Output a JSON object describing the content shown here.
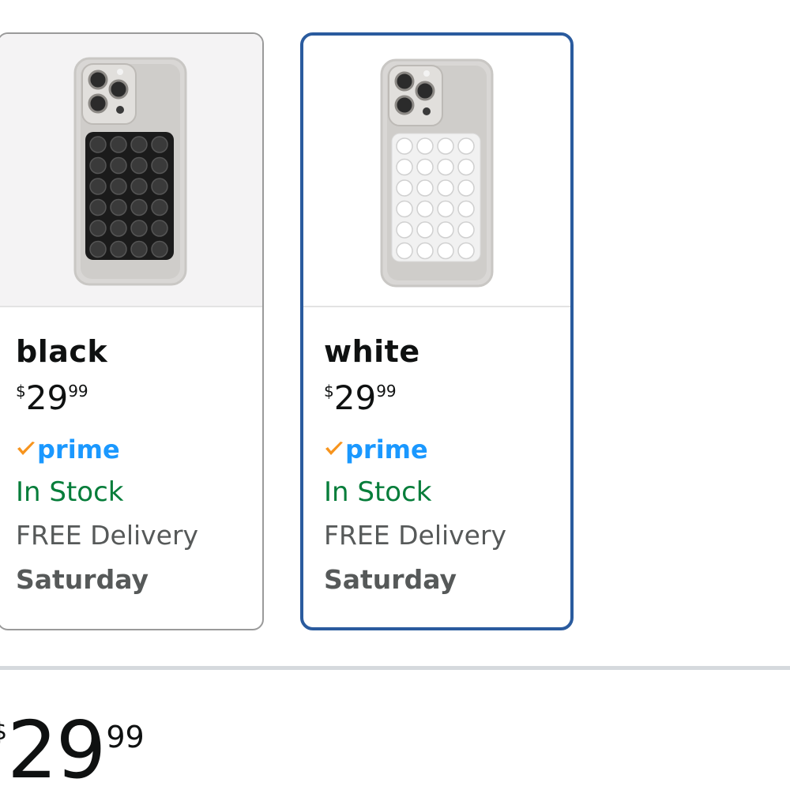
{
  "variants": [
    {
      "color_name": "black",
      "price_symbol": "$",
      "price_whole": "29",
      "price_fraction": "99",
      "prime_label": "prime",
      "stock": "In Stock",
      "delivery": "FREE Delivery",
      "delivery_day": "Saturday",
      "selected": false,
      "pad_color": "#1b1b1b"
    },
    {
      "color_name": "white",
      "price_symbol": "$",
      "price_whole": "29",
      "price_fraction": "99",
      "prime_label": "prime",
      "stock": "In Stock",
      "delivery": "FREE Delivery",
      "delivery_day": "Saturday",
      "selected": true,
      "pad_color": "#f1f1f1"
    }
  ],
  "summary_price": {
    "symbol": "$",
    "whole": "29",
    "fraction": "99"
  },
  "colors": {
    "selected_border": "#2a5b9e",
    "prime_blue": "#1a98ff",
    "prime_check": "#f7941d",
    "in_stock_green": "#067d3a",
    "muted_text": "#565959"
  },
  "icons": {
    "prime_check": "prime-check-icon",
    "product_image": "phone-case-image"
  }
}
